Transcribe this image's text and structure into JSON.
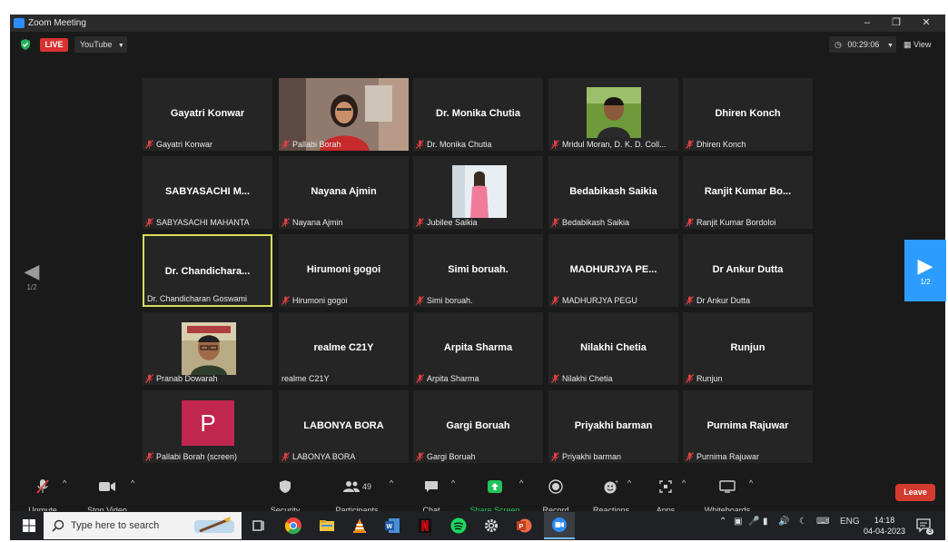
{
  "window": {
    "title": "Zoom Meeting"
  },
  "top": {
    "live": "LIVE",
    "stream": "YouTube",
    "timer": "00:29:06",
    "view": "View"
  },
  "nav": {
    "left_page": "1/2",
    "right_page": "1/2"
  },
  "tiles": [
    {
      "name": "Gayatri Konwar",
      "label": "Gayatri Konwar",
      "muted": true
    },
    {
      "name": "",
      "label": "Pallabi Borah",
      "muted": true,
      "video": "woman-in-red-video"
    },
    {
      "name": "Dr. Monika Chutia",
      "label": "Dr. Monika Chutia",
      "muted": true
    },
    {
      "name": "",
      "label": "Mridul Moran, D. K. D. Coll...",
      "muted": true,
      "video": "man-outdoor-photo"
    },
    {
      "name": "Dhiren Konch",
      "label": "Dhiren Konch",
      "muted": true
    },
    {
      "name": "SABYASACHI M...",
      "label": "SABYASACHI MAHANTA",
      "muted": true
    },
    {
      "name": "Nayana Ajmin",
      "label": "Nayana Ajmin",
      "muted": true
    },
    {
      "name": "",
      "label": "Jubilee Saikia",
      "muted": true,
      "video": "woman-pink-photo"
    },
    {
      "name": "Bedabikash Saikia",
      "label": "Bedabikash Saikia",
      "muted": true
    },
    {
      "name": "Ranjit Kumar Bo...",
      "label": "Ranjit Kumar Bordoloi",
      "muted": true
    },
    {
      "name": "Dr. Chandichara...",
      "label": "Dr. Chandicharan Goswami",
      "muted": false,
      "active": true
    },
    {
      "name": "Hirumoni gogoi",
      "label": "Hirumoni gogoi",
      "muted": true
    },
    {
      "name": "Simi boruah.",
      "label": "Simi boruah.",
      "muted": true
    },
    {
      "name": "MADHURJYA PE...",
      "label": "MADHURJYA PEGU",
      "muted": true
    },
    {
      "name": "Dr Ankur Dutta",
      "label": "Dr Ankur Dutta",
      "muted": true
    },
    {
      "name": "",
      "label": "Pranab Dowarah",
      "muted": true,
      "video": "man-glasses-photo"
    },
    {
      "name": "realme C21Y",
      "label": "realme C21Y",
      "muted": false
    },
    {
      "name": "Arpita Sharma",
      "label": "Arpita Sharma",
      "muted": true
    },
    {
      "name": "Nilakhi Chetia",
      "label": "Nilakhi Chetia",
      "muted": true
    },
    {
      "name": "Runjun",
      "label": "Runjun",
      "muted": true
    },
    {
      "name": "",
      "label": "Pallabi Borah (screen)",
      "muted": true,
      "avatar": "P"
    },
    {
      "name": "LABONYA BORA",
      "label": "LABONYA BORA",
      "muted": true
    },
    {
      "name": "Gargi Boruah",
      "label": "Gargi Boruah",
      "muted": true
    },
    {
      "name": "Priyakhi barman",
      "label": "Priyakhi barman",
      "muted": true
    },
    {
      "name": "Purnima Rajuwar",
      "label": "Purnima Rajuwar",
      "muted": true
    }
  ],
  "toolbar": {
    "unmute": "Unmute",
    "stop_video": "Stop Video",
    "security": "Security",
    "participants": "Participants",
    "participants_count": "49",
    "chat": "Chat",
    "share_screen": "Share Screen",
    "record": "Record",
    "reactions": "Reactions",
    "apps": "Apps",
    "whiteboards": "Whiteboards",
    "leave": "Leave"
  },
  "taskbar": {
    "search_placeholder": "Type here to search",
    "lang": "ENG",
    "time": "14:18",
    "date": "04-04-2023",
    "notifications": "3"
  },
  "colors": {
    "accent": "#2d8cff",
    "live": "#d93131",
    "leave": "#d33b2f",
    "active_border": "#d6dc5b",
    "share": "#22c35a"
  }
}
